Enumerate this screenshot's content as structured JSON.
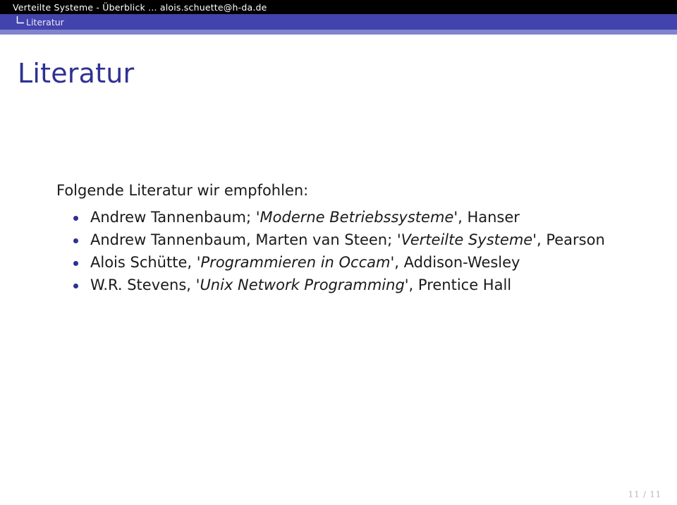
{
  "header": {
    "title_bar_text": "Verteilte Systeme - Überblick ... alois.schuette@h-da.de",
    "nav_branch_icon": "tree-branch-icon",
    "nav_section_label": "Literatur",
    "colors": {
      "title_bar_bg": "#000000",
      "nav_bar_bg": "#4343ad",
      "under_bar_bg": "#8084ce",
      "title_bar_fg": "#ffffff",
      "nav_bar_fg": "#e9e9f7"
    }
  },
  "frame": {
    "title": "Literatur",
    "title_color": "#2e3192",
    "intro": "Folgende Literatur wir empfohlen:",
    "bullet_color": "#2e3192",
    "items": [
      {
        "prefix": "Andrew Tannenbaum; '",
        "italic": "Moderne Betriebssysteme",
        "suffix": "', Hanser"
      },
      {
        "prefix": "Andrew Tannenbaum, Marten van Steen; '",
        "italic": "Verteilte Systeme",
        "suffix": "', Pearson"
      },
      {
        "prefix": "Alois Schütte, '",
        "italic": "Programmieren in Occam",
        "suffix": "', Addison-Wesley"
      },
      {
        "prefix": "W.R. Stevens, '",
        "italic": "Unix Network Programming",
        "suffix": "', Prentice Hall"
      }
    ]
  },
  "footer": {
    "page_indicator": "11 / 11",
    "current_page": "11",
    "total_pages": "11"
  }
}
